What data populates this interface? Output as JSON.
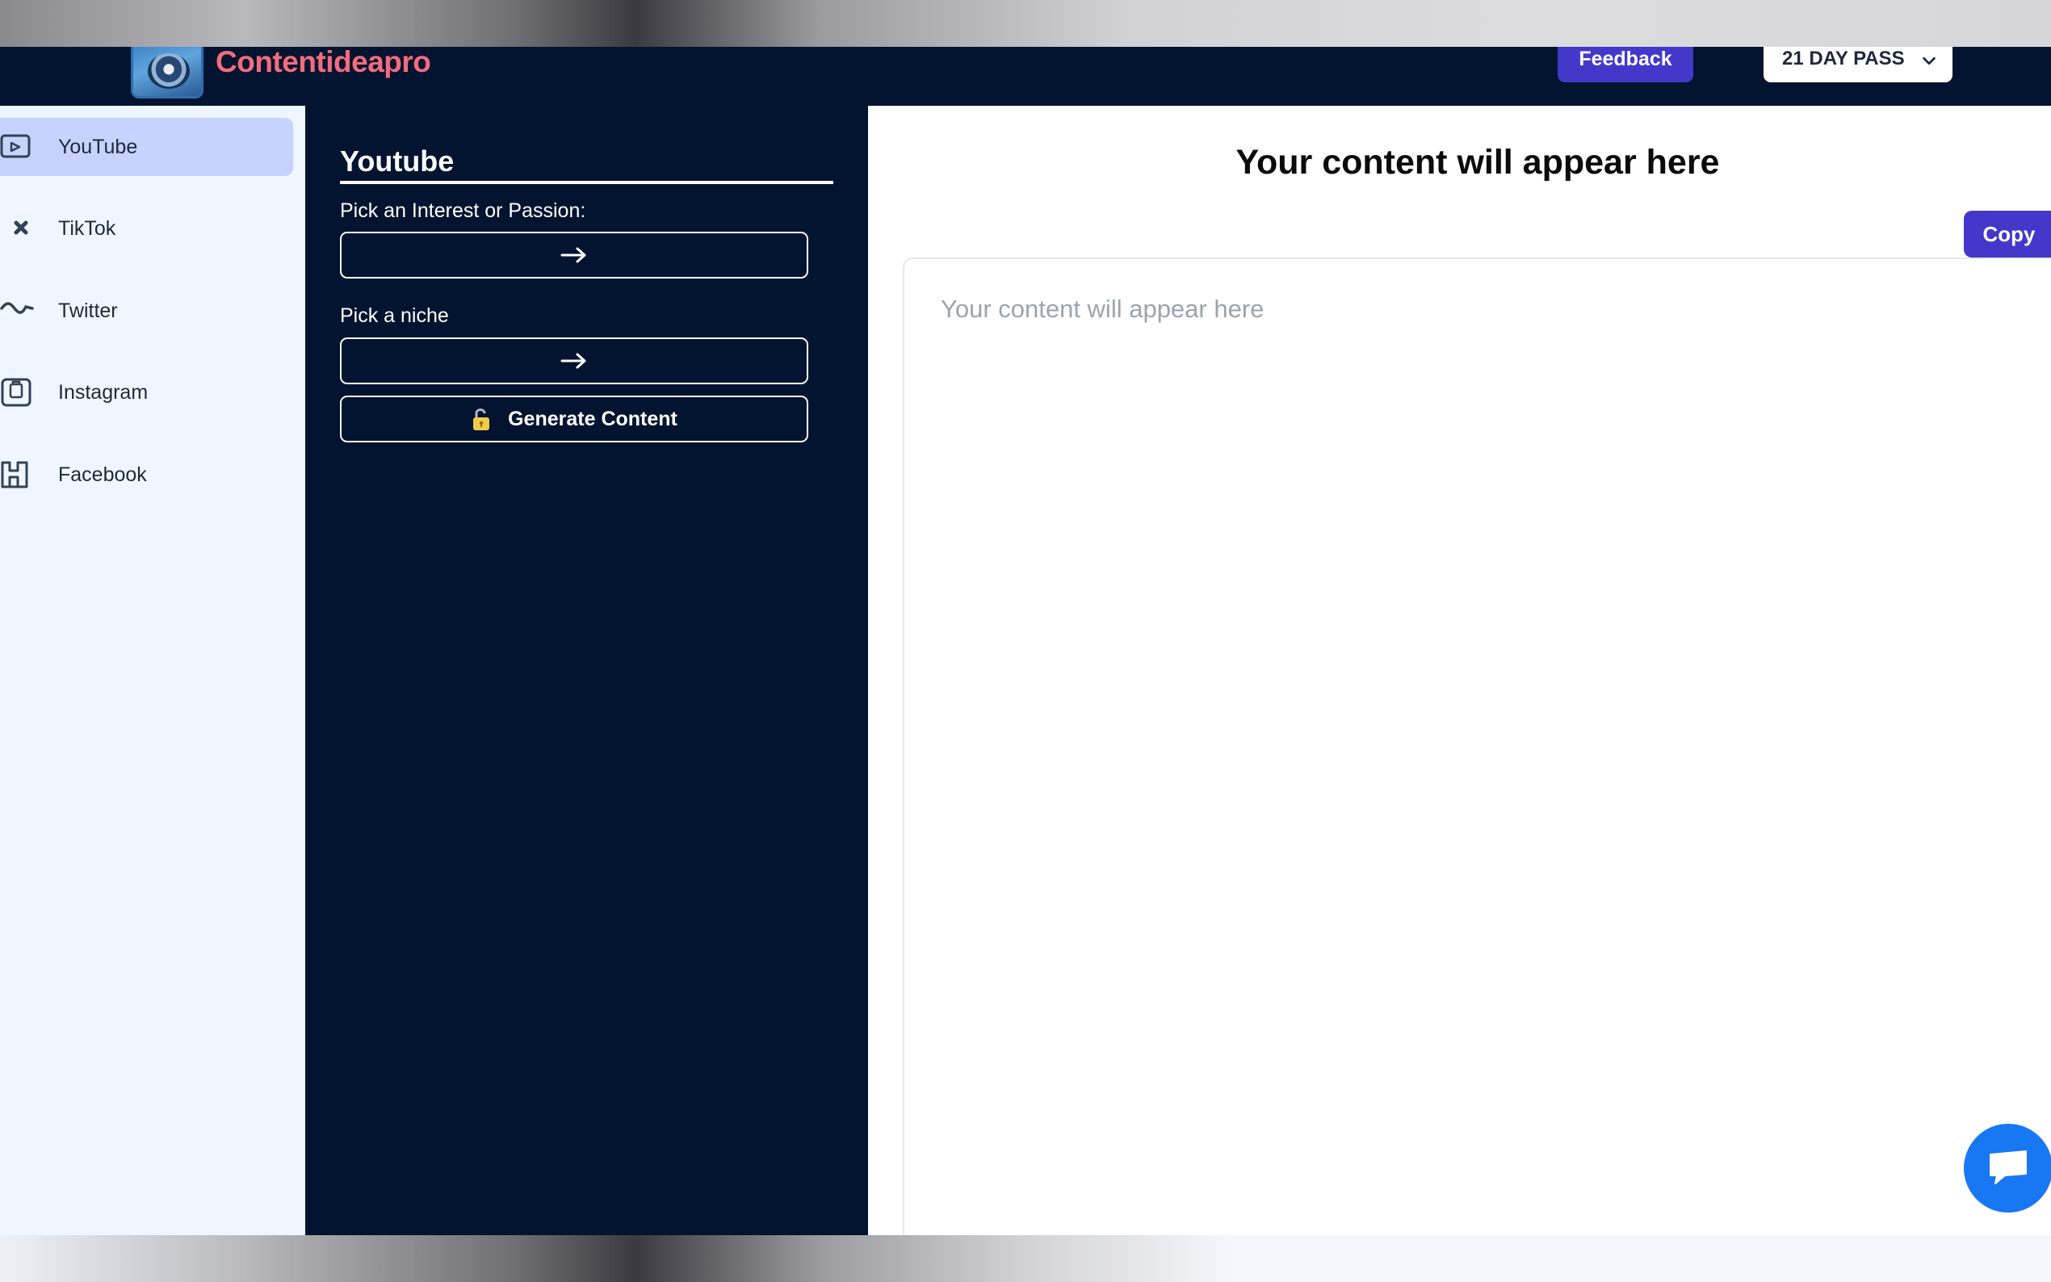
{
  "header": {
    "brand": "Contentideapro",
    "feedback_label": "Feedback",
    "pass_label": "21 DAY PASS",
    "colors": {
      "navbar": "#031430",
      "brand": "#f36c7b",
      "accent": "#4338ca"
    }
  },
  "sidebar": {
    "items": [
      {
        "label": "YouTube",
        "icon": "youtube-icon",
        "active": true
      },
      {
        "label": "TikTok",
        "icon": "tiktok-icon",
        "active": false
      },
      {
        "label": "Twitter",
        "icon": "twitter-icon",
        "active": false
      },
      {
        "label": "Instagram",
        "icon": "instagram-icon",
        "active": false
      },
      {
        "label": "Facebook",
        "icon": "facebook-icon",
        "active": false
      }
    ]
  },
  "form": {
    "title": "Youtube",
    "interest_label": "Pick an Interest or Passion:",
    "niche_label": "Pick a niche",
    "generate_label": "Generate Content"
  },
  "output": {
    "title": "Your content will appear here",
    "copy_label": "Copy",
    "placeholder": "Your content will appear here"
  }
}
